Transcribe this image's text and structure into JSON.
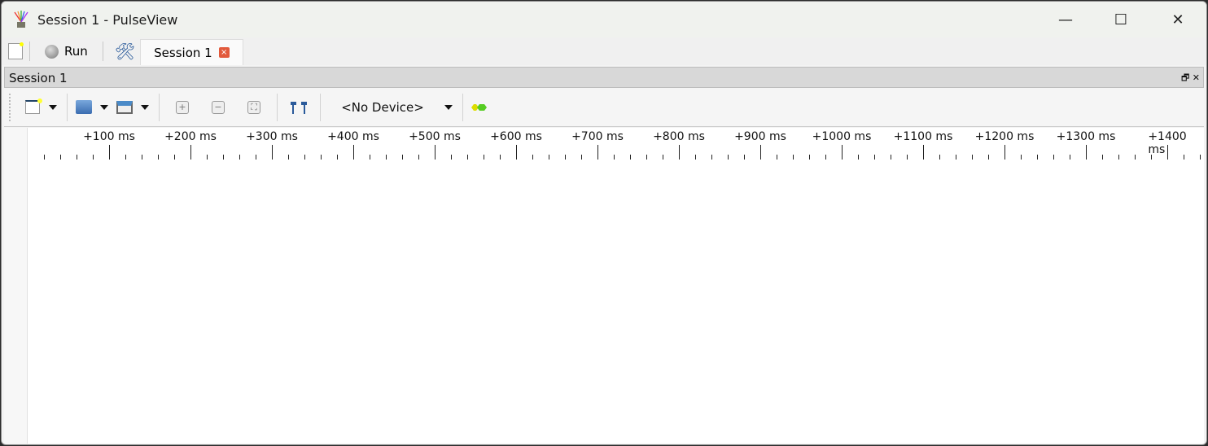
{
  "window": {
    "title": "Session 1 - PulseView",
    "minimize": "—",
    "maximize": "☐",
    "close": "✕"
  },
  "tabbar": {
    "run_label": "Run",
    "tab_label": "Session 1",
    "tab_close": "×"
  },
  "dock": {
    "title": "Session 1",
    "float": "🗗",
    "close": "✕"
  },
  "toolbar": {
    "device": "<No Device>"
  },
  "ruler": {
    "labels": [
      "+100 ms",
      "+200 ms",
      "+300 ms",
      "+400 ms",
      "+500 ms",
      "+600 ms",
      "+700 ms",
      "+800 ms",
      "+900 ms",
      "+1000 ms",
      "+1100 ms",
      "+1200 ms",
      "+1300 ms",
      "+1400 ms"
    ],
    "minor_per_major": 5
  }
}
